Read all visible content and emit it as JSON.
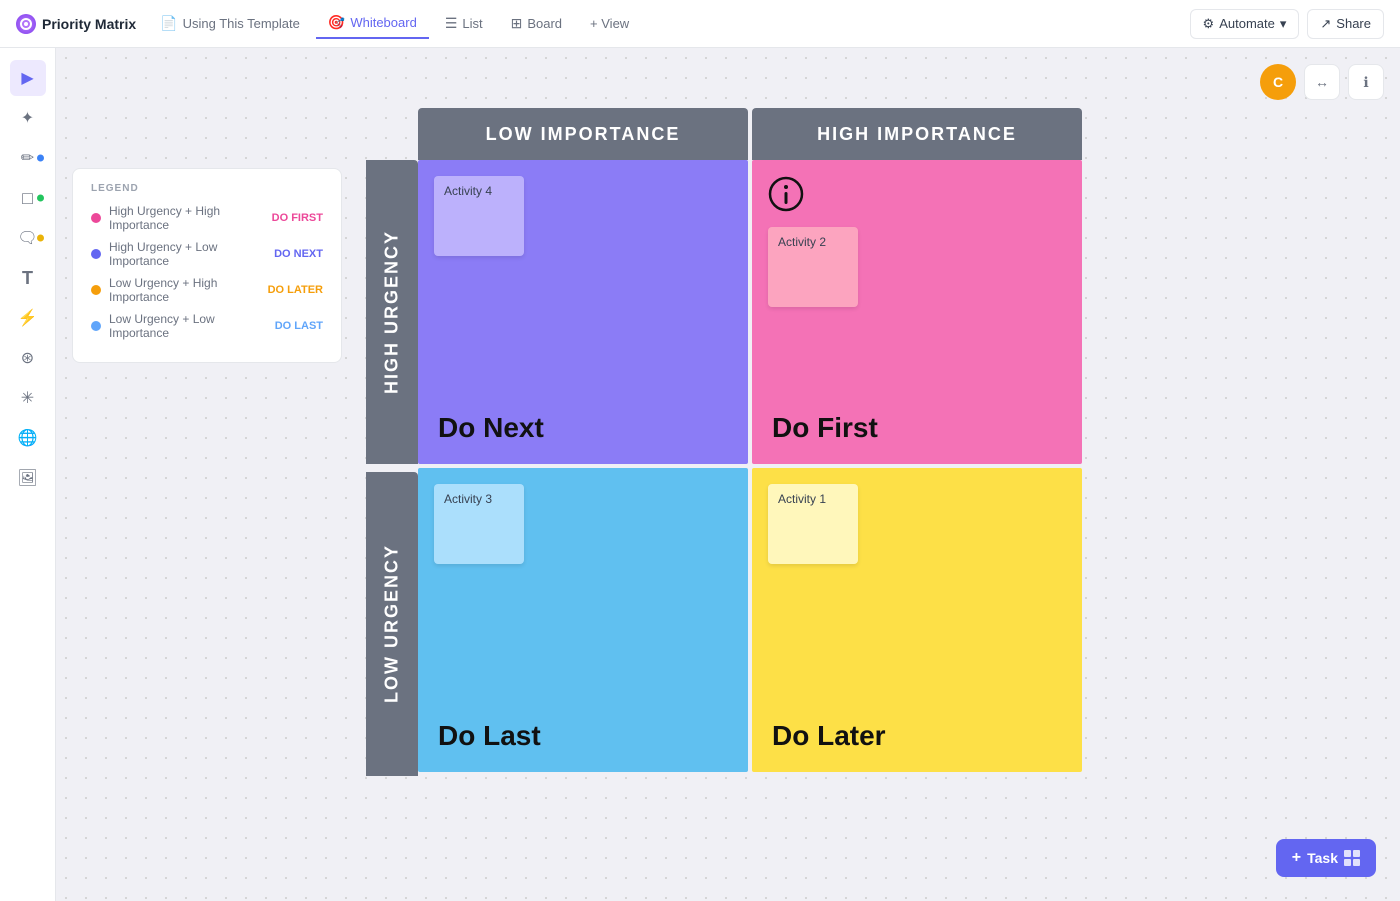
{
  "app": {
    "title": "Priority Matrix",
    "logo_color": "#7c3aed"
  },
  "nav": {
    "tabs": [
      {
        "id": "using-template",
        "label": "Using This Template",
        "icon": "📄",
        "active": false
      },
      {
        "id": "whiteboard",
        "label": "Whiteboard",
        "icon": "🎯",
        "active": true
      },
      {
        "id": "list",
        "label": "List",
        "icon": "☰",
        "active": false
      },
      {
        "id": "board",
        "label": "Board",
        "icon": "⊞",
        "active": false
      },
      {
        "id": "view",
        "label": "+ View",
        "icon": "",
        "active": false
      }
    ],
    "automate_label": "Automate",
    "share_label": "Share"
  },
  "legend": {
    "title": "LEGEND",
    "items": [
      {
        "dot_color": "#ec4899",
        "text": "High Urgency + High Importance",
        "badge": "DO FIRST",
        "badge_color": "#ec4899"
      },
      {
        "dot_color": "#6366f1",
        "text": "High Urgency + Low Importance",
        "badge": "DO NEXT",
        "badge_color": "#6366f1"
      },
      {
        "dot_color": "#f59e0b",
        "text": "Low Urgency + High Importance",
        "badge": "DO LATER",
        "badge_color": "#f59e0b"
      },
      {
        "dot_color": "#60a5fa",
        "text": "Low Urgency + Low Importance",
        "badge": "DO LAST",
        "badge_color": "#60a5fa"
      }
    ]
  },
  "matrix": {
    "col_headers": [
      "LOW IMPORTANCE",
      "HIGH IMPORTANCE"
    ],
    "row_headers": [
      "HIGH URGENCY",
      "LOW URGENCY"
    ],
    "quadrants": [
      {
        "id": "do-next",
        "label": "Do Next",
        "color": "#8b7cf6",
        "position": "top-left"
      },
      {
        "id": "do-first",
        "label": "Do First",
        "color": "#f472b6",
        "position": "top-right"
      },
      {
        "id": "do-last",
        "label": "Do Last",
        "color": "#60c0f0",
        "position": "bottom-left"
      },
      {
        "id": "do-later",
        "label": "Do Later",
        "color": "#fde047",
        "position": "bottom-right"
      }
    ],
    "activities": [
      {
        "id": "activity-4",
        "label": "Activity 4",
        "quadrant": "do-next",
        "style": "purple-light"
      },
      {
        "id": "activity-2",
        "label": "Activity 2",
        "quadrant": "do-first",
        "style": "pink"
      },
      {
        "id": "activity-3",
        "label": "Activity 3",
        "quadrant": "do-last",
        "style": "blue-light"
      },
      {
        "id": "activity-1",
        "label": "Activity 1",
        "quadrant": "do-later",
        "style": "yellow-light"
      }
    ]
  },
  "controls": {
    "avatar_initial": "C",
    "info_icon": "ℹ",
    "expand_icon": "↔"
  },
  "add_task": {
    "label": "Task"
  },
  "tools": [
    {
      "icon": "▶",
      "name": "select",
      "active": true,
      "dot": null
    },
    {
      "icon": "✦",
      "name": "magic",
      "active": false,
      "dot": null
    },
    {
      "icon": "✏️",
      "name": "pen",
      "active": false,
      "dot": "blue"
    },
    {
      "icon": "□",
      "name": "shape",
      "active": false,
      "dot": "green"
    },
    {
      "icon": "🗨",
      "name": "note",
      "active": false,
      "dot": "yellow"
    },
    {
      "icon": "T",
      "name": "text",
      "active": false,
      "dot": null
    },
    {
      "icon": "⚡",
      "name": "connector",
      "active": false,
      "dot": null
    },
    {
      "icon": "⊛",
      "name": "diagram",
      "active": false,
      "dot": null
    },
    {
      "icon": "✳",
      "name": "ai-tools",
      "active": false,
      "dot": null
    },
    {
      "icon": "🌐",
      "name": "embed",
      "active": false,
      "dot": null
    },
    {
      "icon": "🖼",
      "name": "media",
      "active": false,
      "dot": null
    }
  ]
}
